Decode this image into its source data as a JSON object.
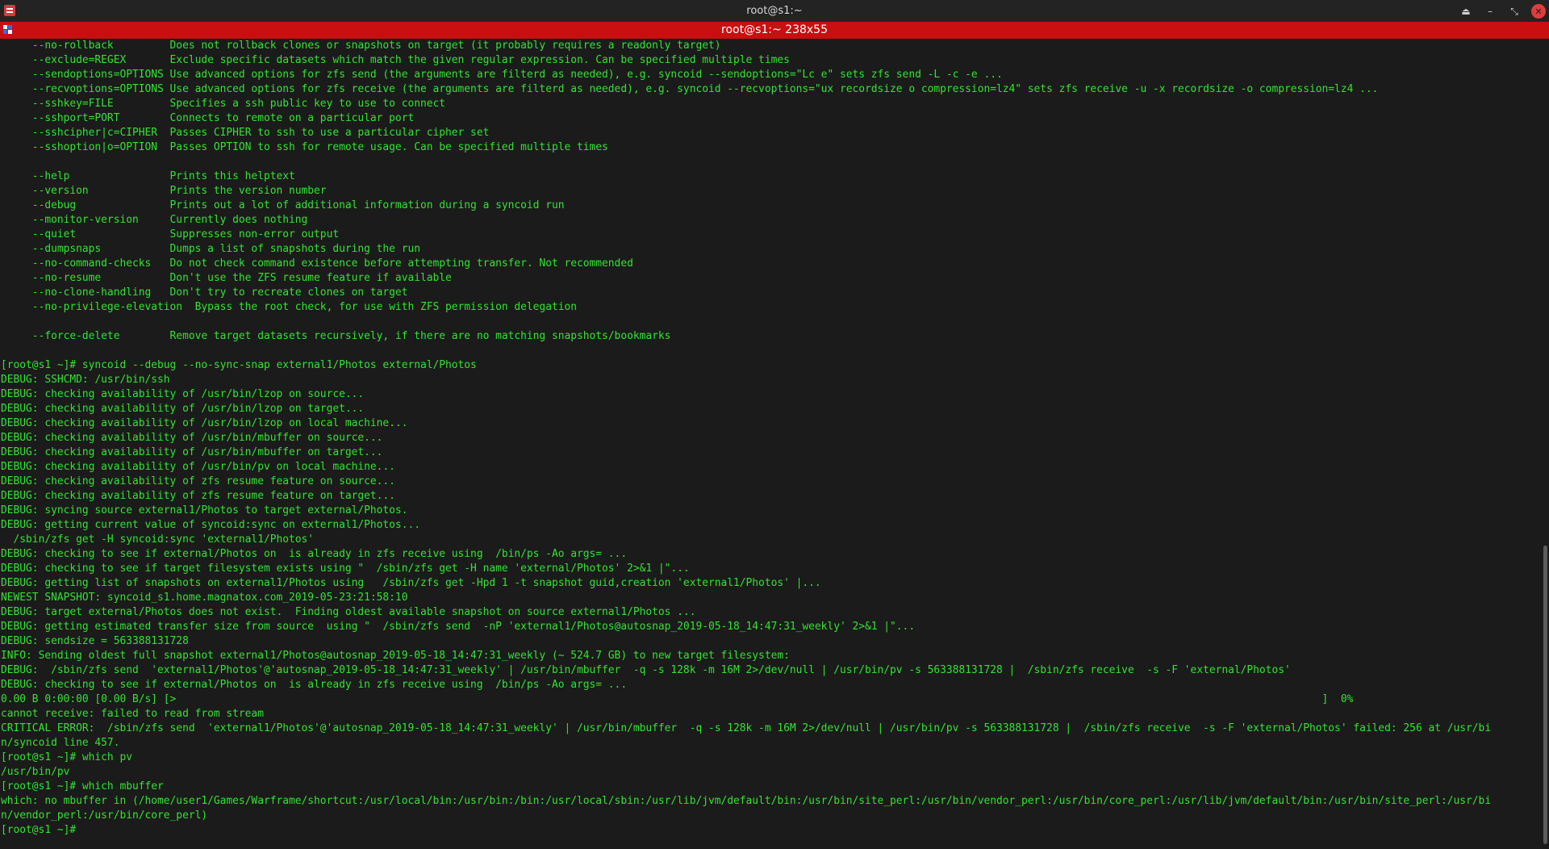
{
  "window": {
    "title": "root@s1:~"
  },
  "tab": {
    "title": "root@s1:~ 238x55"
  },
  "controls": {
    "keep_above_glyph": "⏏",
    "minimize_glyph": "–",
    "maximize_glyph": "⤡",
    "close_glyph": "✕"
  },
  "colors": {
    "terminal_text": "#33e233",
    "tab_bar": "#c90f0f",
    "background": "#1b1b1b"
  },
  "terminal": {
    "lines": [
      "     --no-rollback         Does not rollback clones or snapshots on target (it probably requires a readonly target)",
      "     --exclude=REGEX       Exclude specific datasets which match the given regular expression. Can be specified multiple times",
      "     --sendoptions=OPTIONS Use advanced options for zfs send (the arguments are filterd as needed), e.g. syncoid --sendoptions=\"Lc e\" sets zfs send -L -c -e ...",
      "     --recvoptions=OPTIONS Use advanced options for zfs receive (the arguments are filterd as needed), e.g. syncoid --recvoptions=\"ux recordsize o compression=lz4\" sets zfs receive -u -x recordsize -o compression=lz4 ...",
      "     --sshkey=FILE         Specifies a ssh public key to use to connect",
      "     --sshport=PORT        Connects to remote on a particular port",
      "     --sshcipher|c=CIPHER  Passes CIPHER to ssh to use a particular cipher set",
      "     --sshoption|o=OPTION  Passes OPTION to ssh for remote usage. Can be specified multiple times",
      "",
      "     --help                Prints this helptext",
      "     --version             Prints the version number",
      "     --debug               Prints out a lot of additional information during a syncoid run",
      "     --monitor-version     Currently does nothing",
      "     --quiet               Suppresses non-error output",
      "     --dumpsnaps           Dumps a list of snapshots during the run",
      "     --no-command-checks   Do not check command existence before attempting transfer. Not recommended",
      "     --no-resume           Don't use the ZFS resume feature if available",
      "     --no-clone-handling   Don't try to recreate clones on target",
      "     --no-privilege-elevation  Bypass the root check, for use with ZFS permission delegation",
      "",
      "     --force-delete        Remove target datasets recursively, if there are no matching snapshots/bookmarks",
      "",
      "[root@s1 ~]# syncoid --debug --no-sync-snap external1/Photos external/Photos",
      "DEBUG: SSHCMD: /usr/bin/ssh",
      "DEBUG: checking availability of /usr/bin/lzop on source...",
      "DEBUG: checking availability of /usr/bin/lzop on target...",
      "DEBUG: checking availability of /usr/bin/lzop on local machine...",
      "DEBUG: checking availability of /usr/bin/mbuffer on source...",
      "DEBUG: checking availability of /usr/bin/mbuffer on target...",
      "DEBUG: checking availability of /usr/bin/pv on local machine...",
      "DEBUG: checking availability of zfs resume feature on source...",
      "DEBUG: checking availability of zfs resume feature on target...",
      "DEBUG: syncing source external1/Photos to target external/Photos.",
      "DEBUG: getting current value of syncoid:sync on external1/Photos...",
      "  /sbin/zfs get -H syncoid:sync 'external1/Photos'",
      "DEBUG: checking to see if external/Photos on  is already in zfs receive using  /bin/ps -Ao args= ...",
      "DEBUG: checking to see if target filesystem exists using \"  /sbin/zfs get -H name 'external/Photos' 2>&1 |\"...",
      "DEBUG: getting list of snapshots on external1/Photos using   /sbin/zfs get -Hpd 1 -t snapshot guid,creation 'external1/Photos' |...",
      "NEWEST SNAPSHOT: syncoid_s1.home.magnatox.com_2019-05-23:21:58:10",
      "DEBUG: target external/Photos does not exist.  Finding oldest available snapshot on source external1/Photos ...",
      "DEBUG: getting estimated transfer size from source  using \"  /sbin/zfs send  -nP 'external1/Photos@autosnap_2019-05-18_14:47:31_weekly' 2>&1 |\"...",
      "DEBUG: sendsize = 563388131728",
      "INFO: Sending oldest full snapshot external1/Photos@autosnap_2019-05-18_14:47:31_weekly (~ 524.7 GB) to new target filesystem:",
      "DEBUG:  /sbin/zfs send  'external1/Photos'@'autosnap_2019-05-18_14:47:31_weekly' | /usr/bin/mbuffer  -q -s 128k -m 16M 2>/dev/null | /usr/bin/pv -s 563388131728 |  /sbin/zfs receive  -s -F 'external/Photos'",
      "DEBUG: checking to see if external/Photos on  is already in zfs receive using  /bin/ps -Ao args= ...",
      "0.00 B 0:00:00 [0.00 B/s] [>                                                                                                                                                                                       ]  0%",
      "cannot receive: failed to read from stream",
      "CRITICAL ERROR:  /sbin/zfs send  'external1/Photos'@'autosnap_2019-05-18_14:47:31_weekly' | /usr/bin/mbuffer  -q -s 128k -m 16M 2>/dev/null | /usr/bin/pv -s 563388131728 |  /sbin/zfs receive  -s -F 'external/Photos' failed: 256 at /usr/bi",
      "n/syncoid line 457.",
      "[root@s1 ~]# which pv",
      "/usr/bin/pv",
      "[root@s1 ~]# which mbuffer",
      "which: no mbuffer in (/home/user1/Games/Warframe/shortcut:/usr/local/bin:/usr/bin:/bin:/usr/local/sbin:/usr/lib/jvm/default/bin:/usr/bin/site_perl:/usr/bin/vendor_perl:/usr/bin/core_perl:/usr/lib/jvm/default/bin:/usr/bin/site_perl:/usr/bi",
      "n/vendor_perl:/usr/bin/core_perl)",
      "[root@s1 ~]#"
    ]
  }
}
